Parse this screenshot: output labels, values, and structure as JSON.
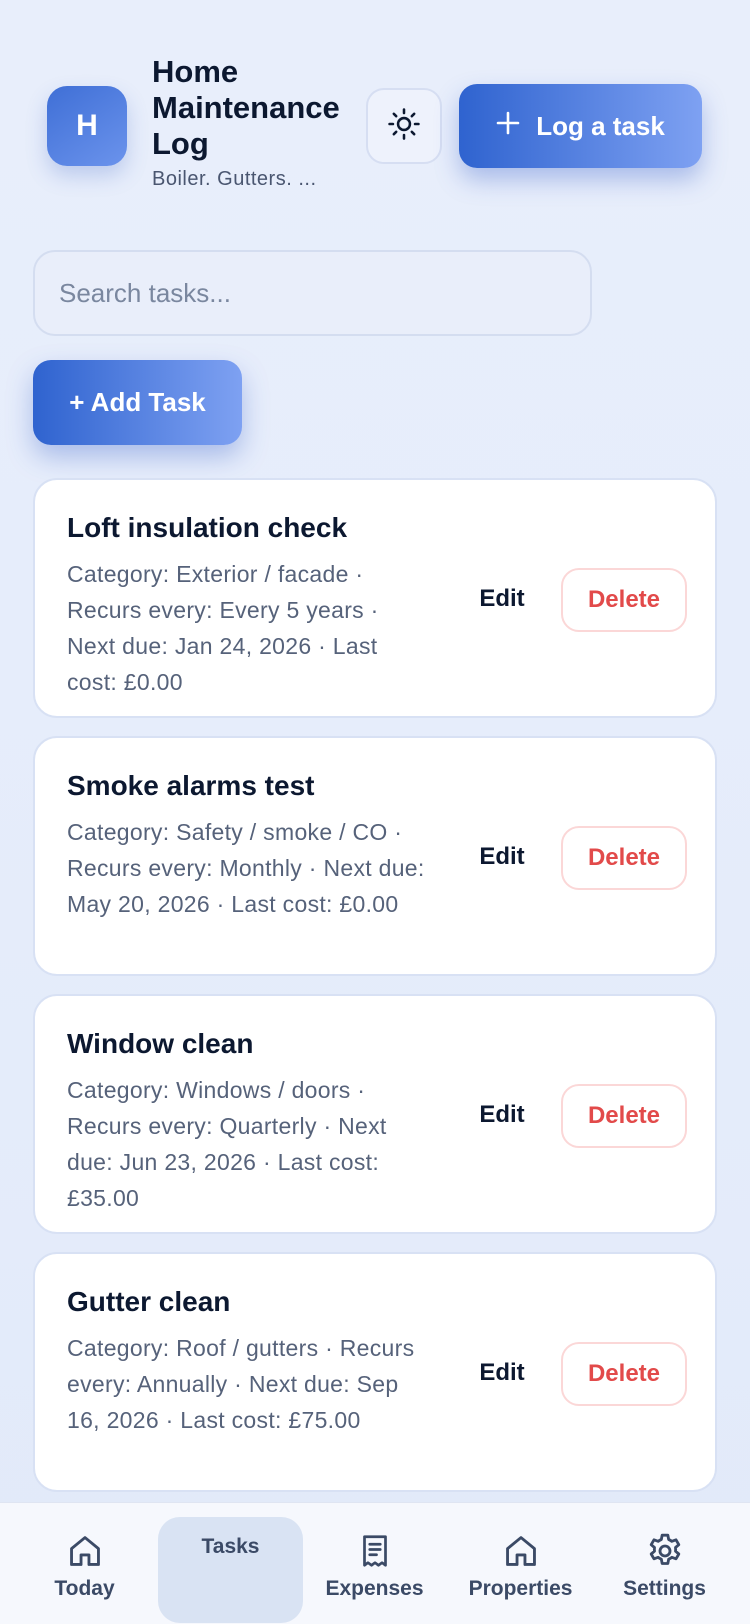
{
  "header": {
    "logo_letter": "H",
    "title": "Home Maintenance Log",
    "subtitle": "Boiler. Gutters. ...",
    "log_task_label": "Log a task"
  },
  "search": {
    "placeholder": "Search tasks..."
  },
  "add_task_label": "+ Add Task",
  "tasks": [
    {
      "name": "Loft insulation check",
      "meta": "Category: Exterior / facade · Recurs every: Every 5 years · Next due: Jan 24, 2026 · Last cost: £0.00",
      "edit_label": "Edit",
      "delete_label": "Delete"
    },
    {
      "name": "Smoke alarms test",
      "meta": "Category: Safety / smoke / CO · Recurs every: Monthly · Next due: May 20, 2026 · Last cost: £0.00",
      "edit_label": "Edit",
      "delete_label": "Delete"
    },
    {
      "name": "Window clean",
      "meta": "Category: Windows / doors · Recurs every: Quarterly · Next due: Jun 23, 2026 · Last cost: £35.00",
      "edit_label": "Edit",
      "delete_label": "Delete"
    },
    {
      "name": "Gutter clean",
      "meta": "Category: Roof / gutters · Recurs every: Annually · Next due: Sep 16, 2026 · Last cost: £75.00",
      "edit_label": "Edit",
      "delete_label": "Delete"
    }
  ],
  "nav": [
    {
      "label": "Today",
      "icon": "home-icon",
      "active": false
    },
    {
      "label": "Tasks",
      "icon": "none",
      "active": true
    },
    {
      "label": "Expenses",
      "icon": "receipt-icon",
      "active": false
    },
    {
      "label": "Properties",
      "icon": "home-icon",
      "active": false
    },
    {
      "label": "Settings",
      "icon": "gear-icon",
      "active": false
    }
  ],
  "colors": {
    "accent": "#3a6ad6",
    "danger": "#e24a4a",
    "background": "#e6edfb"
  }
}
